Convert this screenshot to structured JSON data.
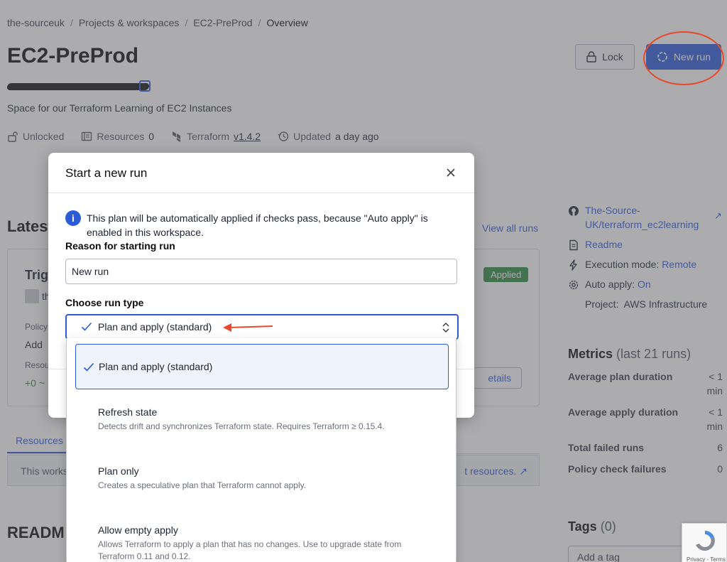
{
  "breadcrumb": {
    "items": [
      "the-sourceuk",
      "Projects & workspaces",
      "EC2-PreProd"
    ],
    "current": "Overview",
    "separator": "/"
  },
  "workspace": {
    "title": "EC2-PreProd",
    "description": "Space for our Terraform Learning of EC2 Instances"
  },
  "meta": {
    "lock_status": "Unlocked",
    "resources_label": "Resources",
    "resources_count": "0",
    "terraform_label": "Terraform",
    "terraform_version": "v1.4.2",
    "updated_label": "Updated",
    "updated_value": "a day ago"
  },
  "actions": {
    "lock_label": "Lock",
    "new_run_label": "New run"
  },
  "latest_run": {
    "heading": "Latest",
    "view_all": "View all runs",
    "trigger": "Trig",
    "user_initial": "th",
    "status": "Applied",
    "policy_label": "Policy",
    "add_text": "Add",
    "resources_label": "Resou",
    "resource_change": "+0 ~",
    "details_label": "etails"
  },
  "tabs": {
    "resources": "Resources"
  },
  "info_bar": {
    "text": "This works",
    "link": "t resources."
  },
  "readme_heading": "READM",
  "sidebar": {
    "repo_line1": "The-Source-",
    "repo_line2": "UK/terraform_ec2learning",
    "readme": "Readme",
    "execution_label": "Execution mode:",
    "execution_value": "Remote",
    "auto_apply_label": "Auto apply:",
    "auto_apply_value": "On",
    "project_label": "Project:",
    "project_value": "AWS Infrastructure"
  },
  "metrics": {
    "title": "Metrics",
    "subtitle": "(last 21 runs)",
    "rows": [
      {
        "label": "Average plan duration",
        "value_line1": "< 1",
        "value_line2": "min"
      },
      {
        "label": "Average apply duration",
        "value_line1": "< 1",
        "value_line2": "min"
      },
      {
        "label": "Total failed runs",
        "value_line1": "6",
        "value_line2": ""
      },
      {
        "label": "Policy check failures",
        "value_line1": "0",
        "value_line2": ""
      }
    ]
  },
  "tags": {
    "title": "Tags",
    "count": "(0)",
    "input_placeholder": "Add a tag"
  },
  "recaptcha": {
    "label": "Privacy - Terms"
  },
  "modal": {
    "title": "Start a new run",
    "notice": "This plan will be automatically applied if checks pass, because \"Auto apply\" is enabled in this workspace.",
    "reason_label": "Reason for starting run",
    "reason_value": "New run",
    "run_type_label": "Choose run type",
    "selected_run_type": "Plan and apply (standard)"
  },
  "dropdown": {
    "options": [
      {
        "title": "Plan and apply (standard)",
        "description": "",
        "selected": true
      },
      {
        "title": "Refresh state",
        "description": "Detects drift and synchronizes Terraform state. Requires Terraform ≥ 0.15.4."
      },
      {
        "title": "Plan only",
        "description": "Creates a speculative plan that Terraform cannot apply."
      },
      {
        "title": "Allow empty apply",
        "description": "Allows Terraform to apply a plan that has no changes. Use to upgrade state from Terraform 0.11 and 0.12."
      }
    ]
  },
  "colors": {
    "accent": "#2b5bd7",
    "success": "#2d8a3d",
    "annotation": "#e8482c",
    "overlay": "rgba(90, 90, 95, 0.5)"
  }
}
